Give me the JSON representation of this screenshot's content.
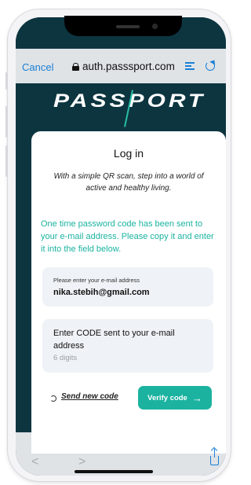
{
  "browser": {
    "cancel_label": "Cancel",
    "url": "auth.passsport.com",
    "lock_icon": "lock-icon",
    "reader_icon": "reader-mode-icon",
    "reload_icon": "reload-icon",
    "back_icon": "back-icon",
    "forward_icon": "forward-icon",
    "share_icon": "share-icon"
  },
  "page": {
    "logo_text": "PASSPORT",
    "title": "Log in",
    "subtitle": "With a simple QR scan, step into a world of active and healthy living.",
    "info_text": "One time password code has been sent to your e-mail address. Please copy it and enter it into the field below.",
    "email_field": {
      "label": "Please enter your e-mail address",
      "value": "nika.stebih@gmail.com"
    },
    "code_field": {
      "label": "Enter CODE sent to your e-mail address",
      "placeholder": "6 digits"
    },
    "resend_label": "Send new code",
    "verify_label": "Verify code",
    "colors": {
      "accent": "#1bb3a0",
      "background": "#0d3540",
      "link": "#1a7fd6"
    }
  }
}
